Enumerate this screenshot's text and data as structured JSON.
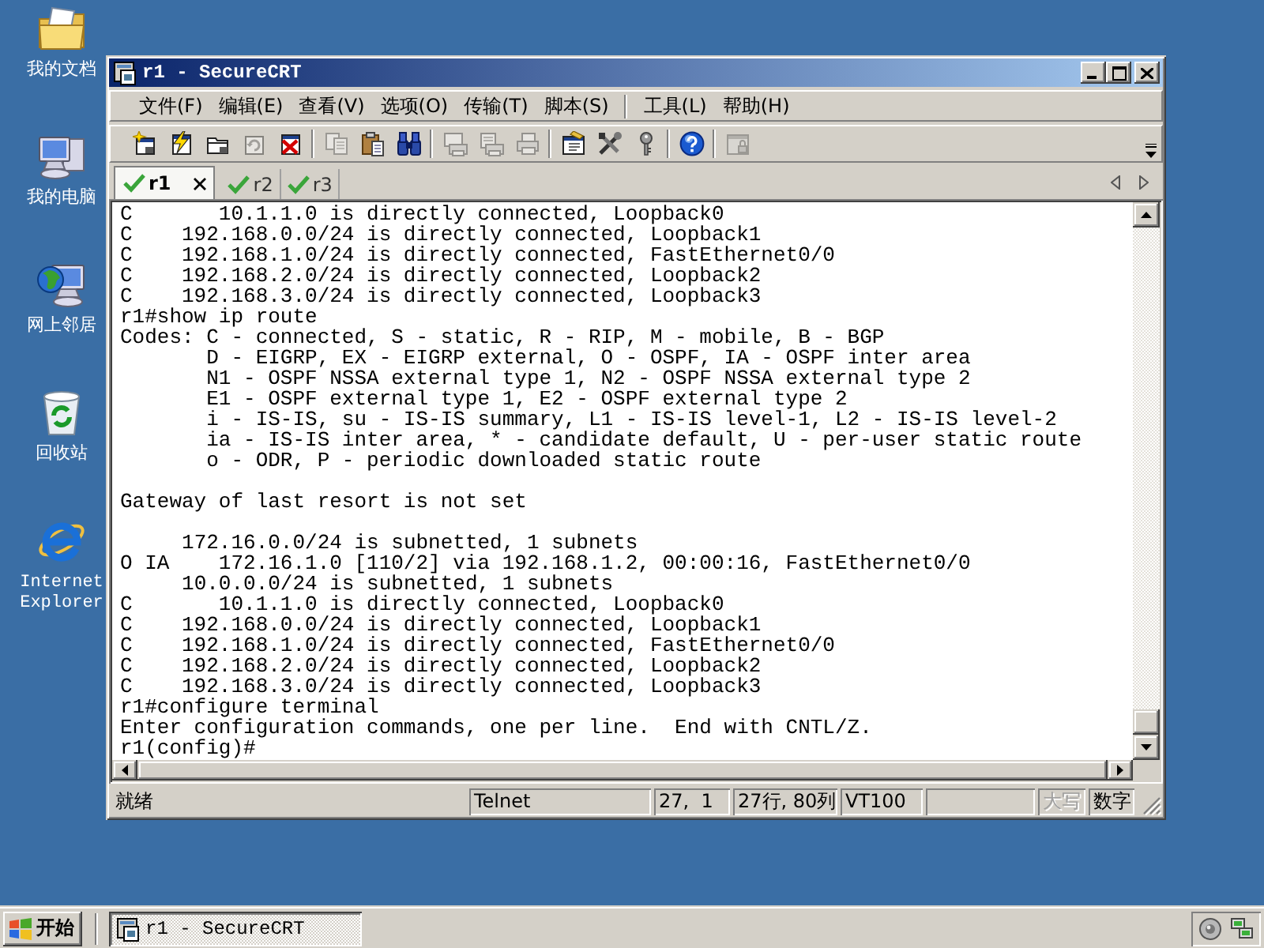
{
  "desktop_icons": [
    {
      "label": "我的文档"
    },
    {
      "label": "我的电脑"
    },
    {
      "label": "网上邻居"
    },
    {
      "label": "回收站"
    },
    {
      "label": "Internet Explorer"
    }
  ],
  "window": {
    "title": "r1 - SecureCRT"
  },
  "menu": {
    "groups": [
      [
        "文件(F)",
        "编辑(E)",
        "查看(V)",
        "选项(O)",
        "传输(T)",
        "脚本(S)"
      ],
      [
        "工具(L)",
        "帮助(H)"
      ]
    ]
  },
  "toolbar": {
    "groups": [
      [
        {
          "disabled": false
        },
        {
          "disabled": false
        },
        {
          "disabled": false
        },
        {
          "disabled": true
        },
        {
          "disabled": false
        }
      ],
      [
        {
          "disabled": true
        },
        {
          "disabled": false
        },
        {
          "disabled": false
        }
      ],
      [
        {
          "disabled": true
        },
        {
          "disabled": true
        },
        {
          "disabled": true
        }
      ],
      [
        {
          "disabled": false
        },
        {
          "disabled": false
        },
        {
          "disabled": false
        }
      ],
      [
        {
          "disabled": false
        }
      ],
      [
        {
          "disabled": true
        }
      ]
    ]
  },
  "tabs": [
    {
      "label": "r1",
      "selected": true,
      "connected": true
    },
    {
      "label": "r2",
      "selected": false,
      "connected": true
    },
    {
      "label": "r3",
      "selected": false,
      "connected": true
    }
  ],
  "terminal": {
    "blocks": [
      [
        "C       10.1.1.0 is directly connected, Loopback0",
        "C    192.168.0.0/24 is directly connected, Loopback1",
        "C    192.168.1.0/24 is directly connected, FastEthernet0/0",
        "C    192.168.2.0/24 is directly connected, Loopback2",
        "C    192.168.3.0/24 is directly connected, Loopback3",
        "r1#show ip route",
        "Codes: C - connected, S - static, R - RIP, M - mobile, B - BGP",
        "       D - EIGRP, EX - EIGRP external, O - OSPF, IA - OSPF inter area",
        "       N1 - OSPF NSSA external type 1, N2 - OSPF NSSA external type 2",
        "       E1 - OSPF external type 1, E2 - OSPF external type 2",
        "       i - IS-IS, su - IS-IS summary, L1 - IS-IS level-1, L2 - IS-IS level-2",
        "       ia - IS-IS inter area, * - candidate default, U - per-user static route",
        "       o - ODR, P - periodic downloaded static route"
      ],
      [
        "Gateway of last resort is not set"
      ],
      [
        "     172.16.0.0/24 is subnetted, 1 subnets",
        "O IA    172.16.1.0 [110/2] via 192.168.1.2, 00:00:16, FastEthernet0/0",
        "     10.0.0.0/24 is subnetted, 1 subnets",
        "C       10.1.1.0 is directly connected, Loopback0",
        "C    192.168.0.0/24 is directly connected, Loopback1",
        "C    192.168.1.0/24 is directly connected, FastEthernet0/0",
        "C    192.168.2.0/24 is directly connected, Loopback2",
        "C    192.168.3.0/24 is directly connected, Loopback3",
        "r1#configure terminal",
        "Enter configuration commands, one per line.  End with CNTL/Z.",
        "r1(config)#"
      ]
    ]
  },
  "status_bar": {
    "message": "就绪",
    "panels": [
      {
        "kind": "field",
        "text": "Telnet"
      },
      {
        "kind": "field",
        "text": "27,  1"
      },
      {
        "kind": "field",
        "text": "27行, 80列"
      },
      {
        "kind": "field",
        "text": "VT100"
      },
      {
        "kind": "blank"
      },
      {
        "kind": "indicator",
        "text": "大写",
        "on": false
      },
      {
        "kind": "indicator",
        "text": "数字",
        "on": true
      }
    ]
  },
  "taskbar": {
    "start_label": "开始",
    "tasks": [
      {
        "label": "r1 - SecureCRT",
        "selected": true
      }
    ]
  }
}
